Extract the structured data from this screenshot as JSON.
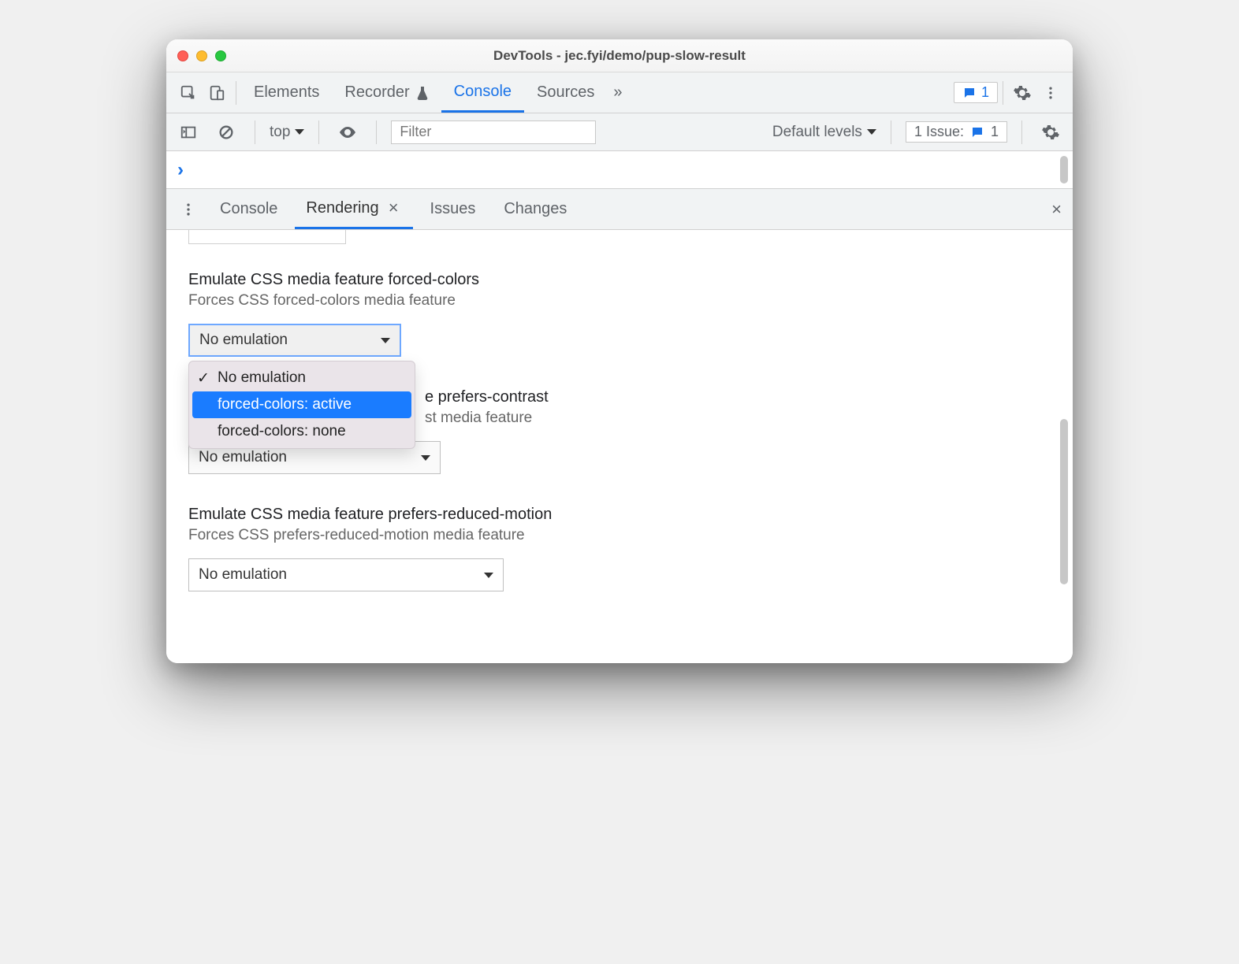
{
  "window": {
    "title": "DevTools - jec.fyi/demo/pup-slow-result"
  },
  "topbar": {
    "tabs": {
      "elements": "Elements",
      "recorder": "Recorder",
      "console": "Console",
      "sources": "Sources"
    },
    "more_glyph": "»",
    "badge_count": "1"
  },
  "filterbar": {
    "context": "top",
    "filter_placeholder": "Filter",
    "levels": "Default levels",
    "issues_label": "1 Issue:",
    "issues_count": "1"
  },
  "prompt": {
    "glyph": "›"
  },
  "drawer": {
    "tabs": {
      "console": "Console",
      "rendering": "Rendering",
      "issues": "Issues",
      "changes": "Changes"
    }
  },
  "rendering": {
    "forced_colors": {
      "title": "Emulate CSS media feature forced-colors",
      "sub": "Forces CSS forced-colors media feature",
      "value": "No emulation",
      "options": [
        "No emulation",
        "forced-colors: active",
        "forced-colors: none"
      ]
    },
    "prefers_contrast": {
      "title_fragment": "e prefers-contrast",
      "sub_fragment": "st media feature",
      "partial_value": "No emulation"
    },
    "prefers_reduced_motion": {
      "title": "Emulate CSS media feature prefers-reduced-motion",
      "sub": "Forces CSS prefers-reduced-motion media feature",
      "value": "No emulation"
    }
  }
}
